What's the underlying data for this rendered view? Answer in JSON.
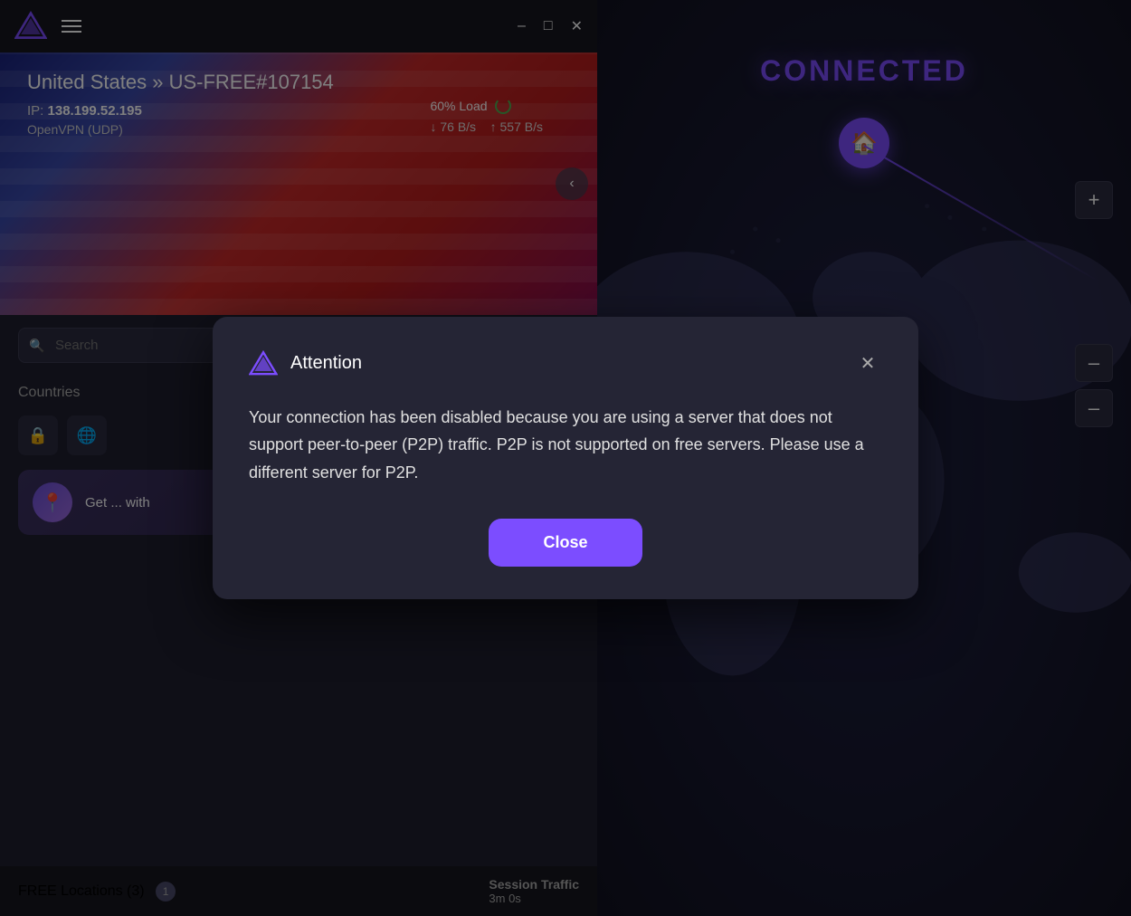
{
  "titleBar": {
    "appName": "ProtonVPN",
    "minimizeLabel": "–",
    "maximizeLabel": "□",
    "closeLabel": "✕"
  },
  "serverBanner": {
    "country": "United States",
    "serverName": "US-FREE#107154",
    "separator": "»",
    "ipLabel": "IP:",
    "ipAddress": "138.199.52.195",
    "protocol": "OpenVPN (UDP)",
    "loadLabel": "60% Load",
    "downloadSpeed": "↓ 76 B/s",
    "uploadSpeed": "↑ 557 B/s"
  },
  "search": {
    "placeholder": "Search"
  },
  "sidebar": {
    "countriesLabel": "Countries",
    "filterIcons": [
      "🔒",
      "🌐"
    ]
  },
  "promo": {
    "text": "Get",
    "subtext": "with"
  },
  "footer": {
    "freeLocationsLabel": "FREE Locations (3)",
    "badgeCount": "1",
    "sessionTrafficLabel": "Session Traffic",
    "sessionValue": "3m 0s"
  },
  "rightPanel": {
    "connectedLabel": "CONNECTED",
    "homeIcon": "🏠",
    "zoomPlusLabel": "+",
    "zoomMinus1Label": "–",
    "zoomMinus2Label": "–"
  },
  "modal": {
    "titleText": "Attention",
    "closeIconLabel": "✕",
    "bodyText": "Your connection has been disabled because you are using a server that does not support peer-to-peer (P2P) traffic. P2P is not supported on free servers. Please use a different server for P2P.",
    "closeButtonLabel": "Close"
  }
}
